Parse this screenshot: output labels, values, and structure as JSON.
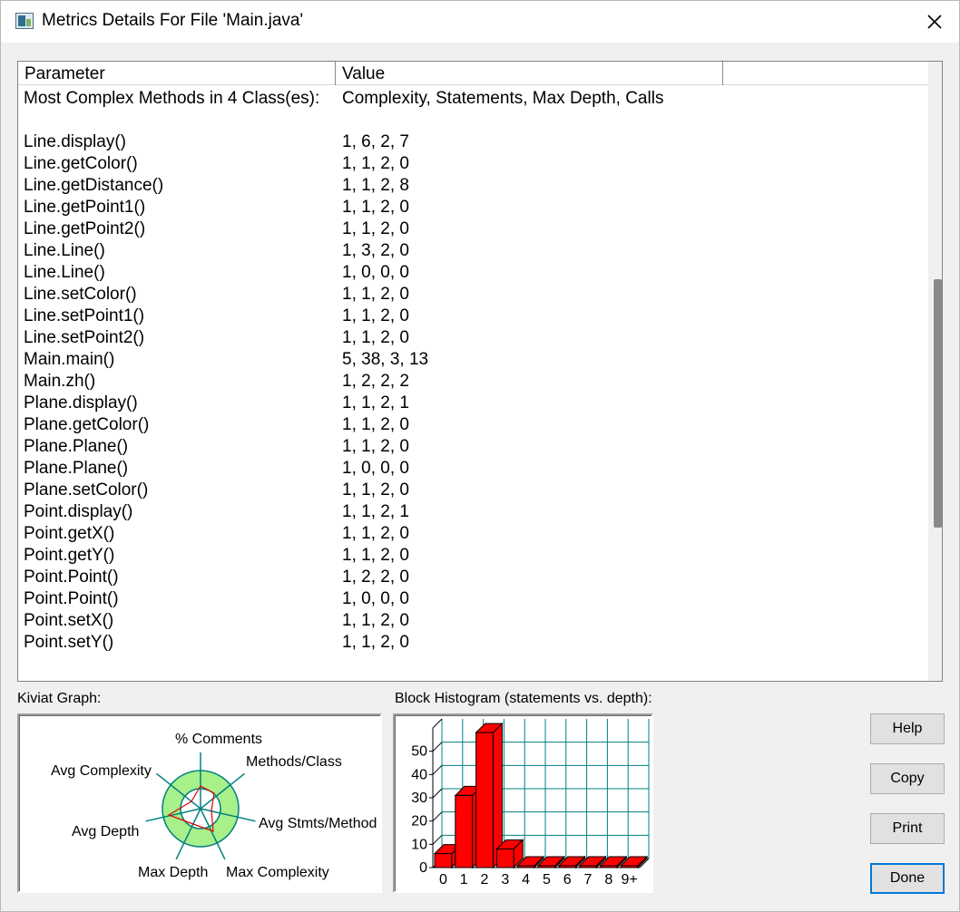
{
  "window": {
    "title": "Metrics Details For File 'Main.java'"
  },
  "listview": {
    "columns": [
      "Parameter",
      "Value",
      ""
    ],
    "rows": [
      {
        "param": "Most Complex Methods in 4 Class(es):",
        "value": "Complexity, Statements, Max Depth, Calls"
      },
      {
        "param": "",
        "value": ""
      },
      {
        "param": "Line.display()",
        "value": "1, 6, 2, 7"
      },
      {
        "param": "Line.getColor()",
        "value": "1, 1, 2, 0"
      },
      {
        "param": "Line.getDistance()",
        "value": "1, 1, 2, 8"
      },
      {
        "param": "Line.getPoint1()",
        "value": "1, 1, 2, 0"
      },
      {
        "param": "Line.getPoint2()",
        "value": "1, 1, 2, 0"
      },
      {
        "param": "Line.Line()",
        "value": "1, 3, 2, 0"
      },
      {
        "param": "Line.Line()",
        "value": "1, 0, 0, 0"
      },
      {
        "param": "Line.setColor()",
        "value": "1, 1, 2, 0"
      },
      {
        "param": "Line.setPoint1()",
        "value": "1, 1, 2, 0"
      },
      {
        "param": "Line.setPoint2()",
        "value": "1, 1, 2, 0"
      },
      {
        "param": "Main.main()",
        "value": "5, 38, 3, 13"
      },
      {
        "param": "Main.zh()",
        "value": "1, 2, 2, 2"
      },
      {
        "param": "Plane.display()",
        "value": "1, 1, 2, 1"
      },
      {
        "param": "Plane.getColor()",
        "value": "1, 1, 2, 0"
      },
      {
        "param": "Plane.Plane()",
        "value": "1, 1, 2, 0"
      },
      {
        "param": "Plane.Plane()",
        "value": "1, 0, 0, 0"
      },
      {
        "param": "Plane.setColor()",
        "value": "1, 1, 2, 0"
      },
      {
        "param": "Point.display()",
        "value": "1, 1, 2, 1"
      },
      {
        "param": "Point.getX()",
        "value": "1, 1, 2, 0"
      },
      {
        "param": "Point.getY()",
        "value": "1, 1, 2, 0"
      },
      {
        "param": "Point.Point()",
        "value": "1, 2, 2, 0"
      },
      {
        "param": "Point.Point()",
        "value": "1, 0, 0, 0"
      },
      {
        "param": "Point.setX()",
        "value": "1, 1, 2, 0"
      },
      {
        "param": "Point.setY()",
        "value": "1, 1, 2, 0"
      }
    ]
  },
  "kiviat": {
    "label": "Kiviat Graph:",
    "axes": [
      "% Comments",
      "Methods/Class",
      "Avg Stmts/Method",
      "Max Complexity",
      "Max Depth",
      "Avg Depth",
      "Avg Complexity"
    ],
    "colors": {
      "band": "#a8f08a",
      "axis": "#008080",
      "polygon": "#e00000"
    }
  },
  "histogram": {
    "label": "Block Histogram (statements vs. depth):",
    "colors": {
      "bar": "#ff0000",
      "grid": "#008080"
    }
  },
  "chart_data": {
    "type": "bar",
    "categories": [
      "0",
      "1",
      "2",
      "3",
      "4",
      "5",
      "6",
      "7",
      "8",
      "9+"
    ],
    "values": [
      6,
      31,
      58,
      8,
      0,
      0,
      0,
      0,
      0,
      0
    ],
    "yticks": [
      "0",
      "10",
      "20",
      "30",
      "40",
      "50"
    ],
    "ylim": [
      0,
      60
    ]
  },
  "buttons": {
    "help": "Help",
    "copy": "Copy",
    "print": "Print",
    "done": "Done"
  }
}
